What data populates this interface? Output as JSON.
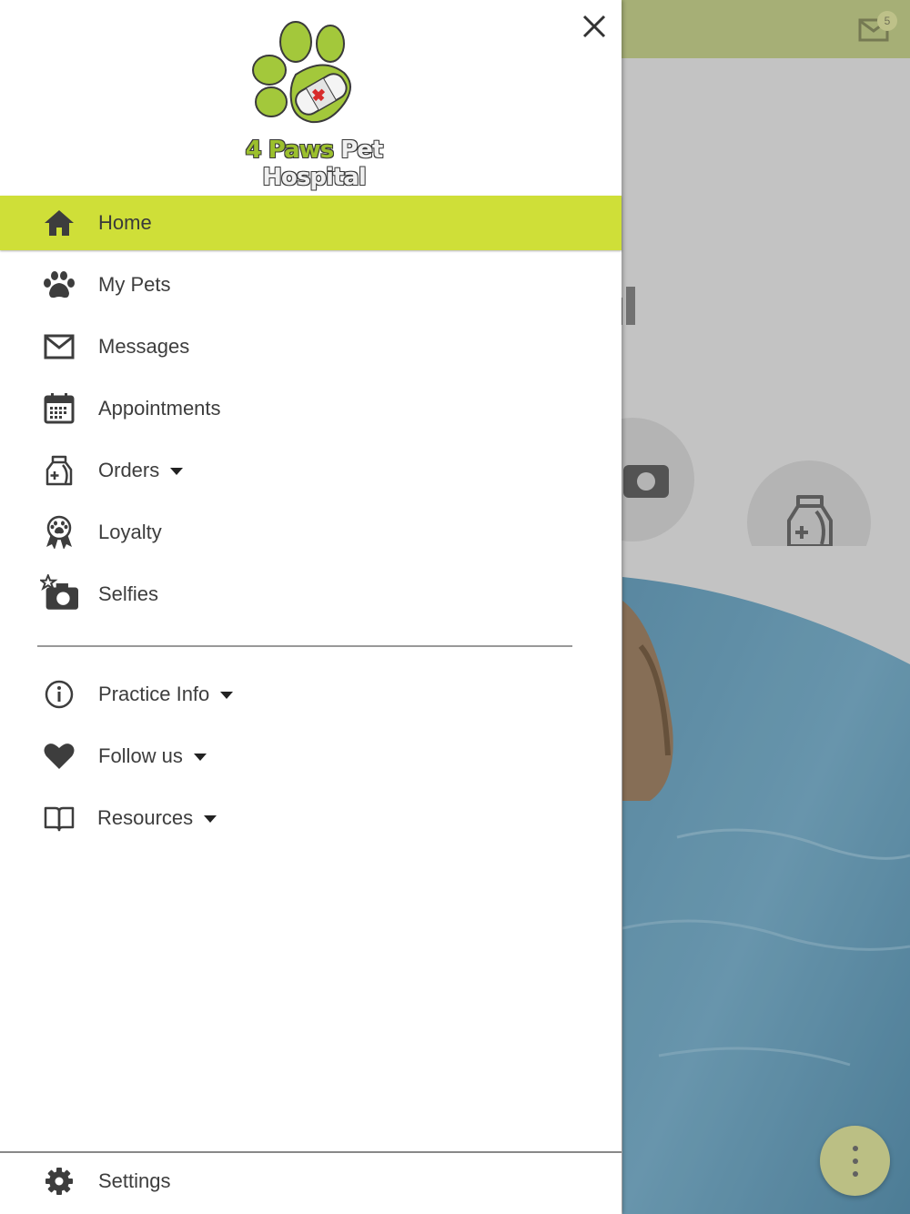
{
  "drawer": {
    "logo": {
      "brand_word1": "4 Paws",
      "brand_word2": "Pet Hospital"
    },
    "items": [
      {
        "label": "Home",
        "icon": "home-icon",
        "active": true
      },
      {
        "label": "My Pets",
        "icon": "paw-icon"
      },
      {
        "label": "Messages",
        "icon": "mail-icon"
      },
      {
        "label": "Appointments",
        "icon": "calendar-icon"
      },
      {
        "label": "Orders",
        "icon": "pet-food-bag-icon",
        "has_dropdown": true
      },
      {
        "label": "Loyalty",
        "icon": "award-ribbon-icon"
      },
      {
        "label": "Selfies",
        "icon": "camera-star-icon"
      }
    ],
    "secondary_items": [
      {
        "label": "Practice Info",
        "icon": "info-icon",
        "has_dropdown": true
      },
      {
        "label": "Follow us",
        "icon": "heart-icon",
        "has_dropdown": true
      },
      {
        "label": "Resources",
        "icon": "book-icon",
        "has_dropdown": true
      }
    ],
    "footer": {
      "label": "Settings",
      "icon": "gear-icon"
    }
  },
  "background": {
    "message_badge_count": "5"
  },
  "colors": {
    "active_item": "#cfdf38",
    "topbar": "#cbd691",
    "brand_green": "#9cc02d",
    "icon_gray": "#3d3d3d"
  }
}
